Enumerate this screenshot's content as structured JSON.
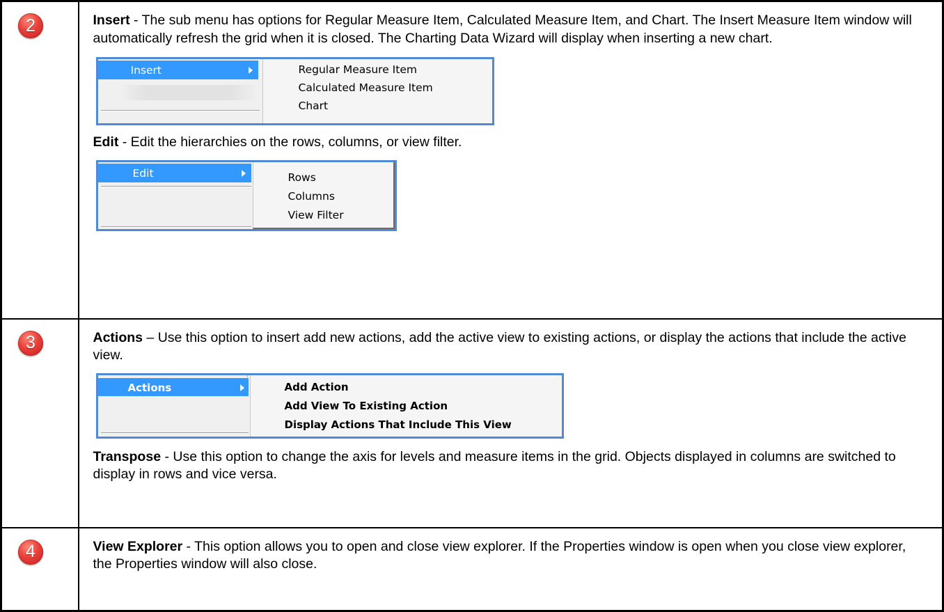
{
  "rows": [
    {
      "badge": "2",
      "sections": [
        {
          "term": "Insert",
          "text": " - The sub menu has options for Regular Measure Item, Calculated Measure Item, and Chart. The Insert Measure Item window will automatically refresh the grid when it is closed. The Charting Data Wizard will display when inserting a new chart.",
          "menu": {
            "label": "Insert",
            "items": [
              "Regular Measure Item",
              "Calculated Measure Item",
              "Chart"
            ]
          }
        },
        {
          "term": "Edit",
          "text": " - Edit the hierarchies on the rows, columns, or view filter.",
          "menu": {
            "label": "Edit",
            "items": [
              "Rows",
              "Columns",
              "View Filter"
            ]
          }
        }
      ]
    },
    {
      "badge": "3",
      "sections": [
        {
          "term": "Actions",
          "text": " – Use this option to insert add new actions, add the active view to existing actions, or display the actions that include the active view.",
          "menu": {
            "label": "Actions",
            "items": [
              "Add Action",
              "Add View To Existing Action",
              "Display Actions That Include This View"
            ]
          }
        },
        {
          "term": "Transpose",
          "text": " - Use this option to change the axis for levels and measure items in the grid. Objects displayed in columns are switched to display in rows and vice versa."
        }
      ]
    },
    {
      "badge": "4",
      "sections": [
        {
          "term": "View Explorer",
          "text": " - This option allows you to open and close view explorer. If the Properties window is open when you close view explorer, the Properties window will also close."
        }
      ]
    }
  ],
  "colors": {
    "menu_highlight": "#3399ff",
    "menu_frame": "#4f8ad6",
    "badge": "#e8403a"
  }
}
